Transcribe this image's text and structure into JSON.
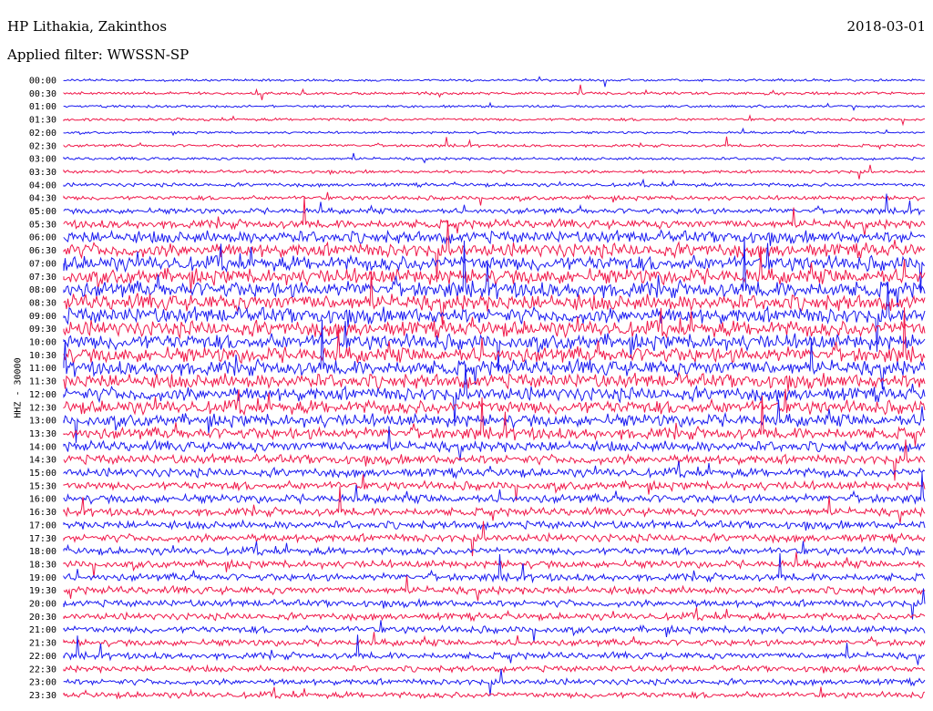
{
  "header": {
    "station": "HP Lithakia, Zakinthos",
    "date": "2018-03-01",
    "filter": "Applied filter: WWSSN-SP"
  },
  "axis": {
    "ylabel": "HHZ - 30000"
  },
  "colors": {
    "trace_a": "#1a1af0",
    "trace_b": "#f0184a",
    "background": "#ffffff"
  },
  "chart_data": {
    "type": "line",
    "title": "HP Lithakia, Zakinthos",
    "subtitle": "Applied filter: WWSSN-SP",
    "ylabel": "HHZ - 30000",
    "row_interval_minutes": 30,
    "categories": [
      "00:00",
      "00:30",
      "01:00",
      "01:30",
      "02:00",
      "02:30",
      "03:00",
      "03:30",
      "04:00",
      "04:30",
      "05:00",
      "05:30",
      "06:00",
      "06:30",
      "07:00",
      "07:30",
      "08:00",
      "08:30",
      "09:00",
      "09:30",
      "10:00",
      "10:30",
      "11:00",
      "11:30",
      "12:00",
      "12:30",
      "13:00",
      "13:30",
      "14:00",
      "14:30",
      "15:00",
      "15:30",
      "16:00",
      "16:30",
      "17:00",
      "17:30",
      "18:00",
      "18:30",
      "19:00",
      "19:30",
      "20:00",
      "20:30",
      "21:00",
      "21:30",
      "22:00",
      "22:30",
      "23:00",
      "23:30"
    ],
    "noise_level": [
      0.5,
      0.6,
      0.5,
      0.6,
      0.5,
      0.6,
      0.6,
      0.7,
      0.8,
      0.9,
      1.2,
      1.8,
      2.6,
      3.0,
      3.2,
      3.3,
      3.4,
      3.4,
      3.4,
      3.4,
      3.3,
      3.3,
      3.2,
      3.1,
      3.0,
      2.9,
      2.7,
      2.5,
      2.2,
      2.0,
      1.9,
      1.8,
      1.8,
      1.7,
      1.7,
      1.7,
      1.6,
      1.6,
      1.6,
      1.6,
      1.5,
      1.5,
      1.5,
      1.4,
      1.4,
      1.3,
      1.3,
      1.3
    ],
    "series": [
      {
        "name": "",
        "color": "trace_a"
      },
      {
        "name": "",
        "color": "trace_b"
      }
    ]
  }
}
